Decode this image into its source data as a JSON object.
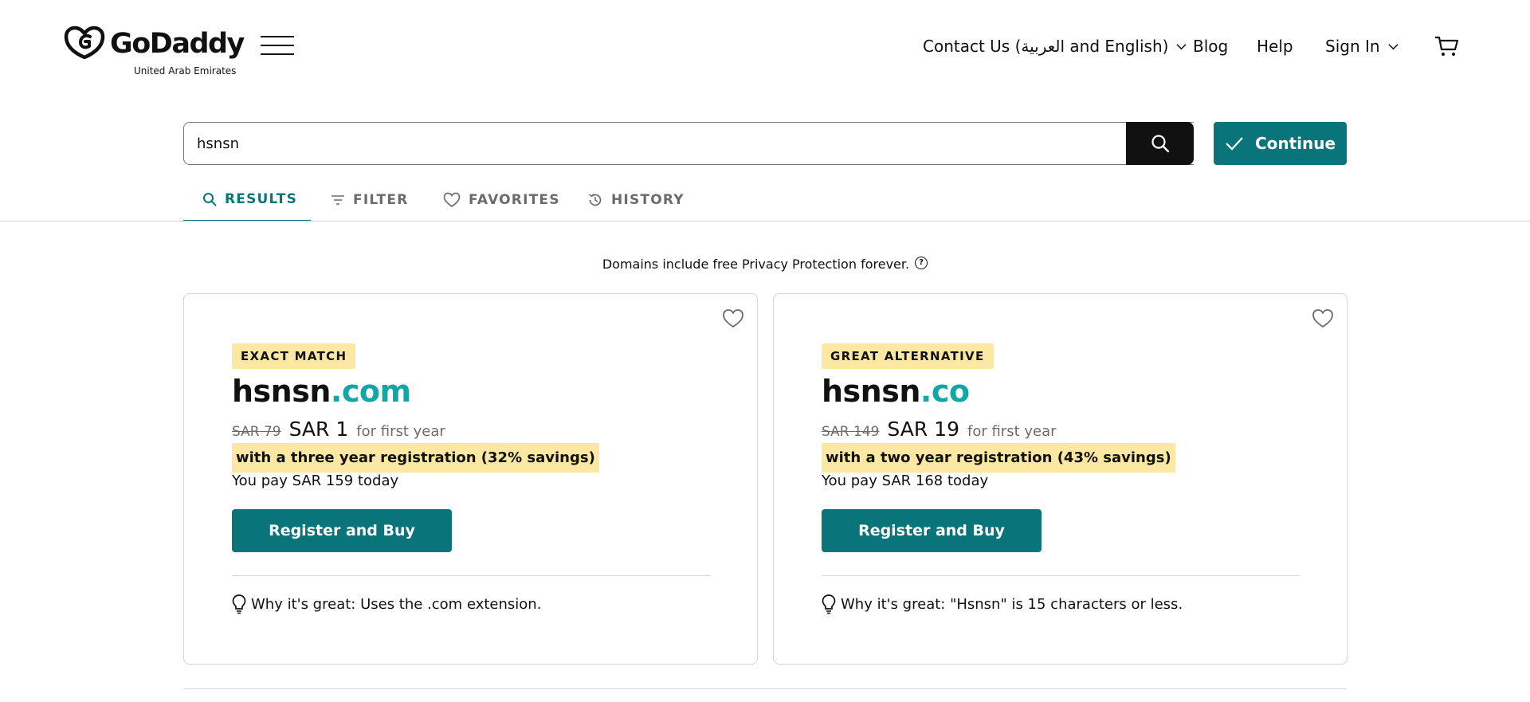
{
  "header": {
    "logo_text": "GoDaddy",
    "logo_sub": "United Arab Emirates",
    "nav": {
      "contact": "Contact Us (العربية and English)",
      "blog": "Blog",
      "help": "Help",
      "signin": "Sign In"
    }
  },
  "search": {
    "value": "hsnsn",
    "continue_label": "Continue"
  },
  "tabs": [
    {
      "label": "RESULTS",
      "active": true
    },
    {
      "label": "FILTER",
      "active": false
    },
    {
      "label": "FAVORITES",
      "active": false
    },
    {
      "label": "HISTORY",
      "active": false
    }
  ],
  "privacy_note": "Domains include free Privacy Protection forever.",
  "cards": [
    {
      "badge": "EXACT MATCH",
      "name": "hsnsn",
      "tld": ".com",
      "old_price": "SAR 79",
      "new_price": "SAR 1",
      "period": "for first year",
      "savings": "with a three year registration (32% savings)",
      "pay": "You pay SAR 159 today",
      "button": "Register and Buy",
      "why": "Why it's great: Uses the .com extension."
    },
    {
      "badge": "GREAT ALTERNATIVE",
      "name": "hsnsn",
      "tld": ".co",
      "old_price": "SAR 149",
      "new_price": "SAR 19",
      "period": "for first year",
      "savings": "with a two year registration (43% savings)",
      "pay": "You pay SAR 168 today",
      "button": "Register and Buy",
      "why": "Why it's great: \"Hsnsn\" is 15 characters or less."
    }
  ],
  "colors": {
    "accent": "#09757a",
    "tld": "#12a7a5",
    "highlight": "#fde8a3"
  }
}
